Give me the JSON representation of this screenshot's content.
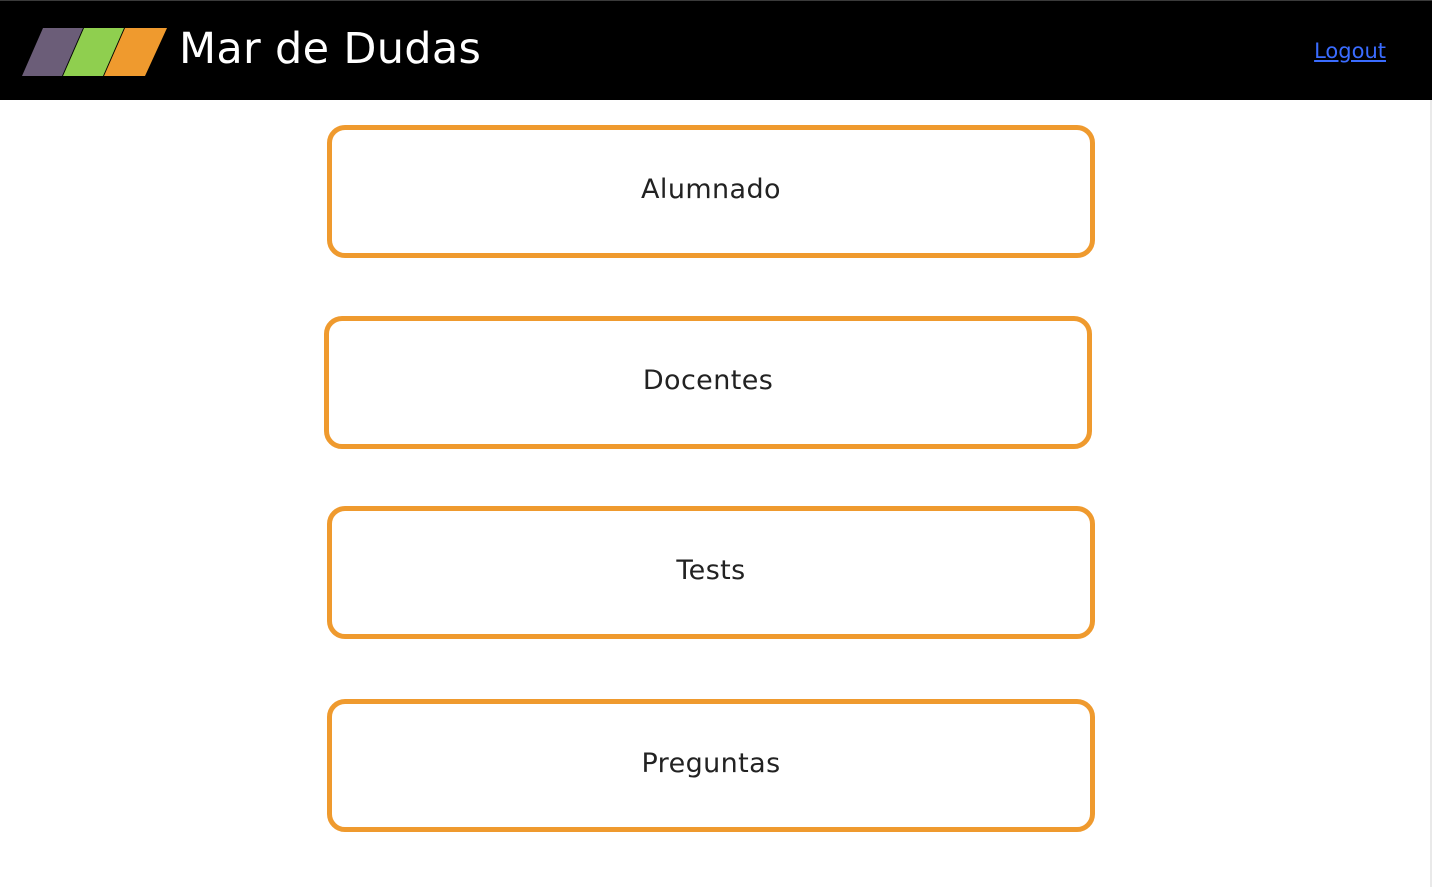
{
  "header": {
    "title": "Mar de Dudas",
    "logout_label": "Logout",
    "logo_colors": [
      "#6b5d78",
      "#8fcf4f",
      "#ef9a2e"
    ]
  },
  "menu": {
    "items": [
      {
        "label": "Alumnado"
      },
      {
        "label": "Docentes"
      },
      {
        "label": "Tests"
      },
      {
        "label": "Preguntas"
      }
    ],
    "border_color": "#ef9a2e"
  }
}
